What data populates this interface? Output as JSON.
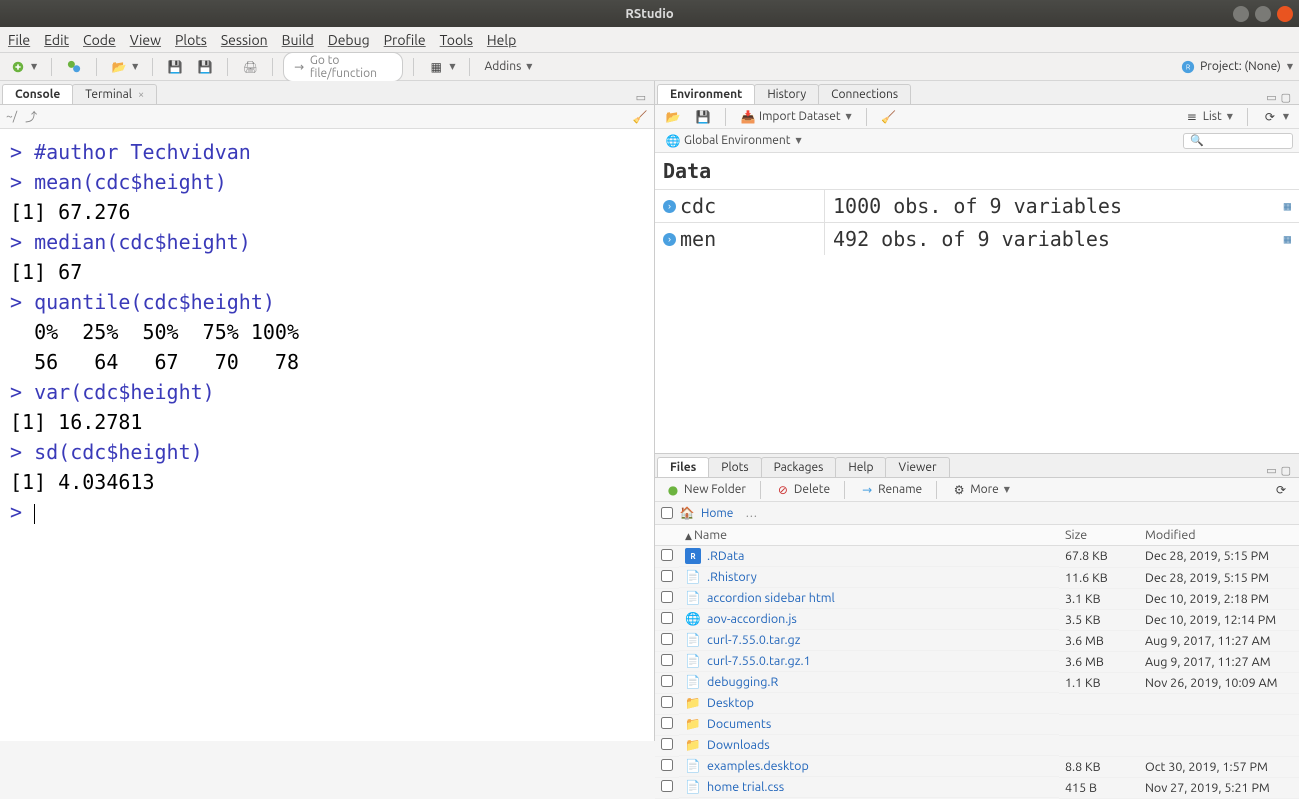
{
  "window": {
    "title": "RStudio"
  },
  "menu": {
    "items": [
      "File",
      "Edit",
      "Code",
      "View",
      "Plots",
      "Session",
      "Build",
      "Debug",
      "Profile",
      "Tools",
      "Help"
    ]
  },
  "toolbar": {
    "goto_placeholder": "Go to file/function",
    "addins": "Addins",
    "project_label": "Project: (None)"
  },
  "left_pane": {
    "tabs": {
      "console": "Console",
      "terminal": "Terminal"
    },
    "path": "~/",
    "console_lines": [
      {
        "t": "p",
        "v": "> "
      },
      {
        "t": "c",
        "v": "#author Techvidvan"
      },
      {
        "t": "nl"
      },
      {
        "t": "p",
        "v": "> "
      },
      {
        "t": "c",
        "v": "mean(cdc$height)"
      },
      {
        "t": "nl"
      },
      {
        "t": "o",
        "v": "[1] 67.276"
      },
      {
        "t": "nl"
      },
      {
        "t": "p",
        "v": "> "
      },
      {
        "t": "c",
        "v": "median(cdc$height)"
      },
      {
        "t": "nl"
      },
      {
        "t": "o",
        "v": "[1] 67"
      },
      {
        "t": "nl"
      },
      {
        "t": "p",
        "v": "> "
      },
      {
        "t": "c",
        "v": "quantile(cdc$height)"
      },
      {
        "t": "nl"
      },
      {
        "t": "o",
        "v": "  0%  25%  50%  75% 100% "
      },
      {
        "t": "nl"
      },
      {
        "t": "o",
        "v": "  56   64   67   70   78 "
      },
      {
        "t": "nl"
      },
      {
        "t": "p",
        "v": "> "
      },
      {
        "t": "c",
        "v": "var(cdc$height)"
      },
      {
        "t": "nl"
      },
      {
        "t": "o",
        "v": "[1] 16.2781"
      },
      {
        "t": "nl"
      },
      {
        "t": "p",
        "v": "> "
      },
      {
        "t": "c",
        "v": "sd(cdc$height)"
      },
      {
        "t": "nl"
      },
      {
        "t": "o",
        "v": "[1] 4.034613"
      },
      {
        "t": "nl"
      },
      {
        "t": "p",
        "v": "> "
      }
    ]
  },
  "env_pane": {
    "tabs": {
      "environment": "Environment",
      "history": "History",
      "connections": "Connections"
    },
    "import": "Import Dataset",
    "view_mode": "List",
    "scope": "Global Environment",
    "data_heading": "Data",
    "rows": [
      {
        "name": "cdc",
        "desc": "1000 obs. of 9 variables"
      },
      {
        "name": "men",
        "desc": "492 obs. of 9 variables"
      }
    ]
  },
  "files_pane": {
    "tabs": {
      "files": "Files",
      "plots": "Plots",
      "packages": "Packages",
      "help": "Help",
      "viewer": "Viewer"
    },
    "new_folder": "New Folder",
    "delete": "Delete",
    "rename": "Rename",
    "more": "More",
    "home": "Home",
    "cols": {
      "name": "Name",
      "size": "Size",
      "modified": "Modified"
    },
    "rows": [
      {
        "ico": "r",
        "name": ".RData",
        "size": "67.8 KB",
        "mod": "Dec 28, 2019, 5:15 PM"
      },
      {
        "ico": "file",
        "name": ".Rhistory",
        "size": "11.6 KB",
        "mod": "Dec 28, 2019, 5:15 PM"
      },
      {
        "ico": "file",
        "name": "accordion sidebar html",
        "size": "3.1 KB",
        "mod": "Dec 10, 2019, 2:18 PM"
      },
      {
        "ico": "js",
        "name": "aov-accordion.js",
        "size": "3.5 KB",
        "mod": "Dec 10, 2019, 12:14 PM"
      },
      {
        "ico": "file",
        "name": "curl-7.55.0.tar.gz",
        "size": "3.6 MB",
        "mod": "Aug 9, 2017, 11:27 AM"
      },
      {
        "ico": "file",
        "name": "curl-7.55.0.tar.gz.1",
        "size": "3.6 MB",
        "mod": "Aug 9, 2017, 11:27 AM"
      },
      {
        "ico": "file",
        "name": "debugging.R",
        "size": "1.1 KB",
        "mod": "Nov 26, 2019, 10:09 AM"
      },
      {
        "ico": "folder",
        "name": "Desktop",
        "size": "",
        "mod": ""
      },
      {
        "ico": "folder",
        "name": "Documents",
        "size": "",
        "mod": ""
      },
      {
        "ico": "folder",
        "name": "Downloads",
        "size": "",
        "mod": ""
      },
      {
        "ico": "file",
        "name": "examples.desktop",
        "size": "8.8 KB",
        "mod": "Oct 30, 2019, 1:57 PM"
      },
      {
        "ico": "file",
        "name": "home trial.css",
        "size": "415 B",
        "mod": "Nov 27, 2019, 5:21 PM"
      }
    ]
  }
}
